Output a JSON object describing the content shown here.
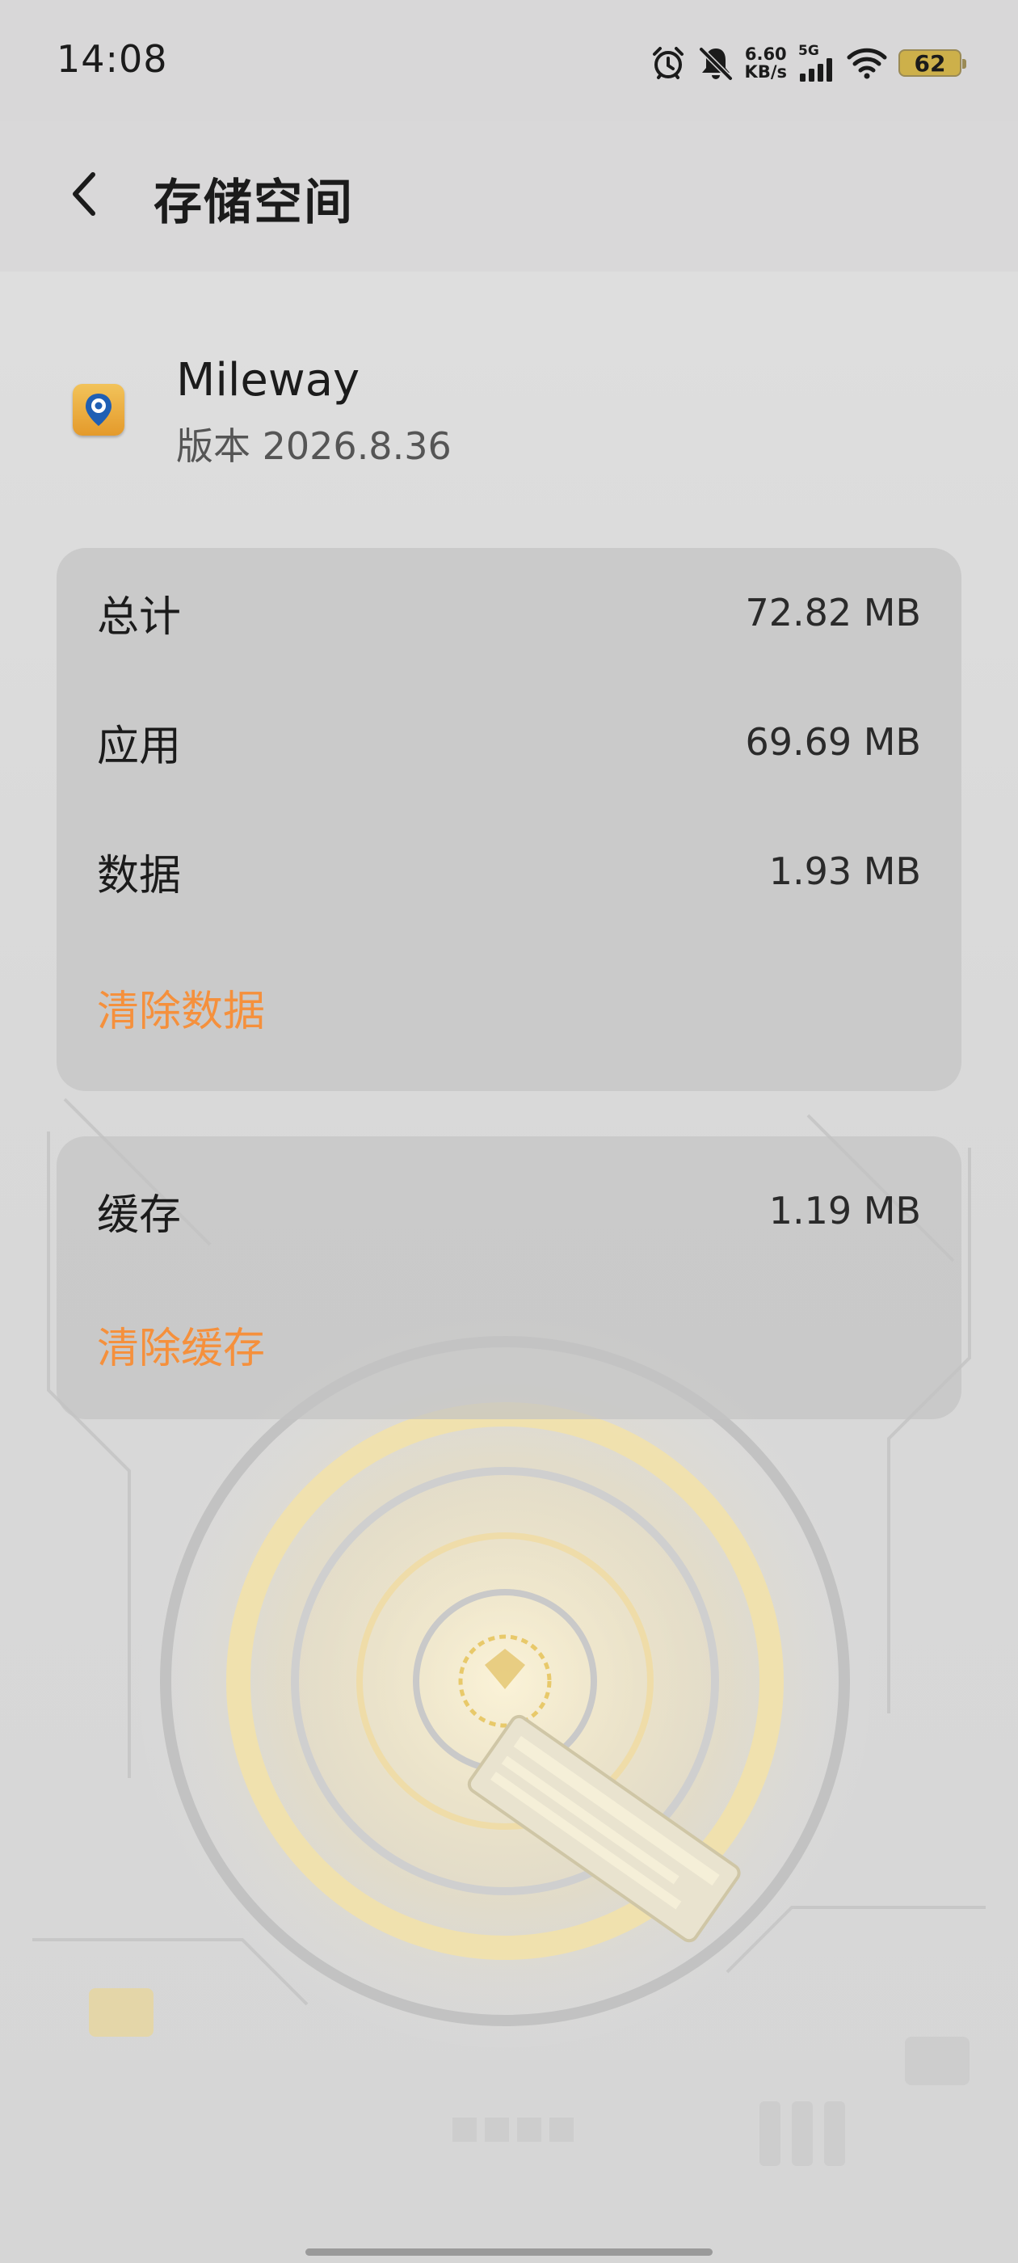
{
  "status_bar": {
    "time": "14:08",
    "net_speed_value": "6.60",
    "net_speed_unit": "KB/s",
    "network_type": "5G",
    "battery": "62",
    "icons": [
      "alarm-icon",
      "mute-bell-icon",
      "signal-icon",
      "wifi-icon",
      "battery-icon"
    ]
  },
  "header": {
    "title": "存储空间",
    "back_icon": "chevron-left-icon"
  },
  "app": {
    "name": "Mileway",
    "version": "版本 2026.8.36",
    "icon": "map-pin-app-icon"
  },
  "storage": {
    "rows": [
      {
        "label": "总计",
        "value": "72.82 MB"
      },
      {
        "label": "应用",
        "value": "69.69 MB"
      },
      {
        "label": "数据",
        "value": "1.93 MB"
      }
    ],
    "clear_data_label": "清除数据"
  },
  "cache": {
    "label": "缓存",
    "value": "1.19 MB",
    "clear_cache_label": "清除缓存"
  },
  "colors": {
    "accent": "#f5903c",
    "card_bg": "#c4c3c3",
    "page_bg": "#dcdcdc"
  }
}
